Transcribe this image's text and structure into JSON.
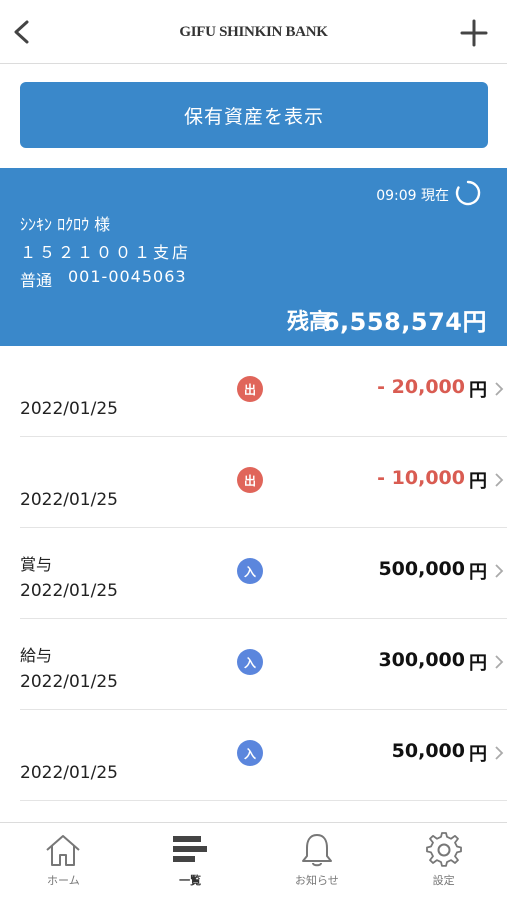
{
  "header": {
    "title": "GIFU SHINKIN BANK",
    "back_icon": "chevron-left-icon",
    "add_icon": "plus-icon"
  },
  "assets_button": {
    "label": "保有資産を表示"
  },
  "account": {
    "timestamp": "09:09 現在",
    "name": "ｼﾝｷﾝ ﾛｸﾛｳ 様",
    "branch": "１５２１００１支店",
    "type": "普通",
    "number": "001-0045063",
    "balance_label": "残高",
    "balance": "6,558,574円"
  },
  "transactions": [
    {
      "description": "",
      "date": "2022/01/25",
      "direction": "出",
      "amount": "- 20,000",
      "currency": "円"
    },
    {
      "description": "",
      "date": "2022/01/25",
      "direction": "出",
      "amount": "- 10,000",
      "currency": "円"
    },
    {
      "description": "賞与",
      "date": "2022/01/25",
      "direction": "入",
      "amount": "500,000",
      "currency": "円"
    },
    {
      "description": "給与",
      "date": "2022/01/25",
      "direction": "入",
      "amount": "300,000",
      "currency": "円"
    },
    {
      "description": "",
      "date": "2022/01/25",
      "direction": "入",
      "amount": "50,000",
      "currency": "円"
    }
  ],
  "tabs": [
    {
      "label": "ホーム",
      "icon": "home-icon",
      "active": false
    },
    {
      "label": "一覧",
      "icon": "list-icon",
      "active": true
    },
    {
      "label": "お知らせ",
      "icon": "bell-icon",
      "active": false
    },
    {
      "label": "設定",
      "icon": "gear-icon",
      "active": false
    }
  ],
  "colors": {
    "brand_blue": "#3a88ca",
    "withdrawal_red": "#d95c52",
    "deposit_blue": "#5b86dd"
  }
}
